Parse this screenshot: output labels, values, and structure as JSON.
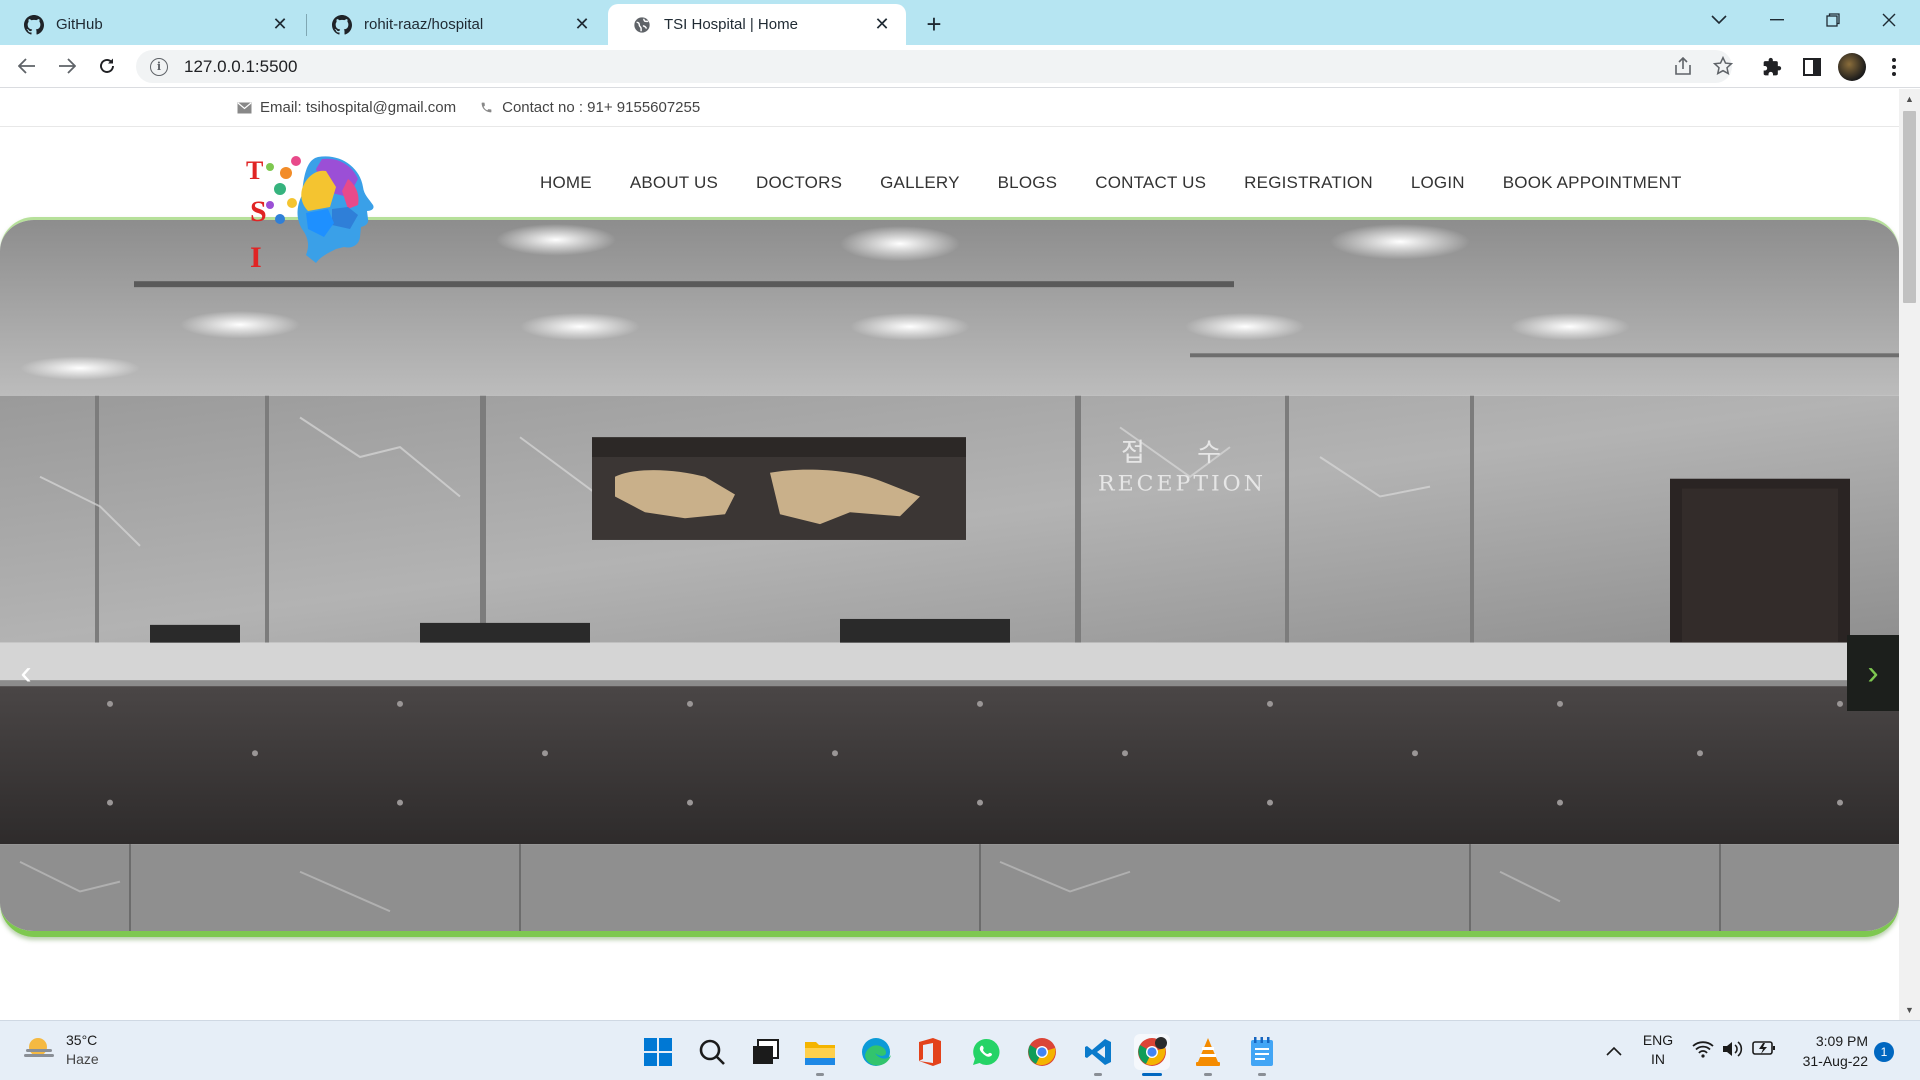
{
  "browser": {
    "tabs": [
      {
        "title": "GitHub",
        "icon": "github-icon",
        "active": false
      },
      {
        "title": "rohit-raaz/hospital",
        "icon": "github-icon",
        "active": false
      },
      {
        "title": "TSI Hospital | Home",
        "icon": "globe-icon",
        "active": true
      }
    ],
    "url": "127.0.0.1:5500"
  },
  "page": {
    "topbar": {
      "email": "Email: tsihospital@gmail.com",
      "contact": "Contact no : 91+ 9155607255"
    },
    "logo_letters": [
      "T",
      "S",
      "I"
    ],
    "nav": [
      "HOME",
      "ABOUT US",
      "DOCTORS",
      "GALLERY",
      "BLOGS",
      "CONTACT US",
      "REGISTRATION",
      "LOGIN",
      "BOOK APPOINTMENT"
    ],
    "hero": {
      "sign_korean": "접 수",
      "sign_english": "RECEPTION",
      "prev_arrow": "‹",
      "next_arrow": "›",
      "accent": "#7ec850"
    }
  },
  "taskbar": {
    "weather": {
      "temp": "35°C",
      "condition": "Haze"
    },
    "apps": [
      "start-icon",
      "search-icon",
      "task-view-icon",
      "file-explorer-icon",
      "edge-icon",
      "office-icon",
      "whatsapp-icon",
      "chrome-icon",
      "vscode-icon",
      "chrome-profile-icon",
      "vlc-icon",
      "notepad-icon"
    ],
    "lang": {
      "line1": "ENG",
      "line2": "IN"
    },
    "time": "3:09 PM",
    "date": "31-Aug-22",
    "notifications": "1"
  }
}
